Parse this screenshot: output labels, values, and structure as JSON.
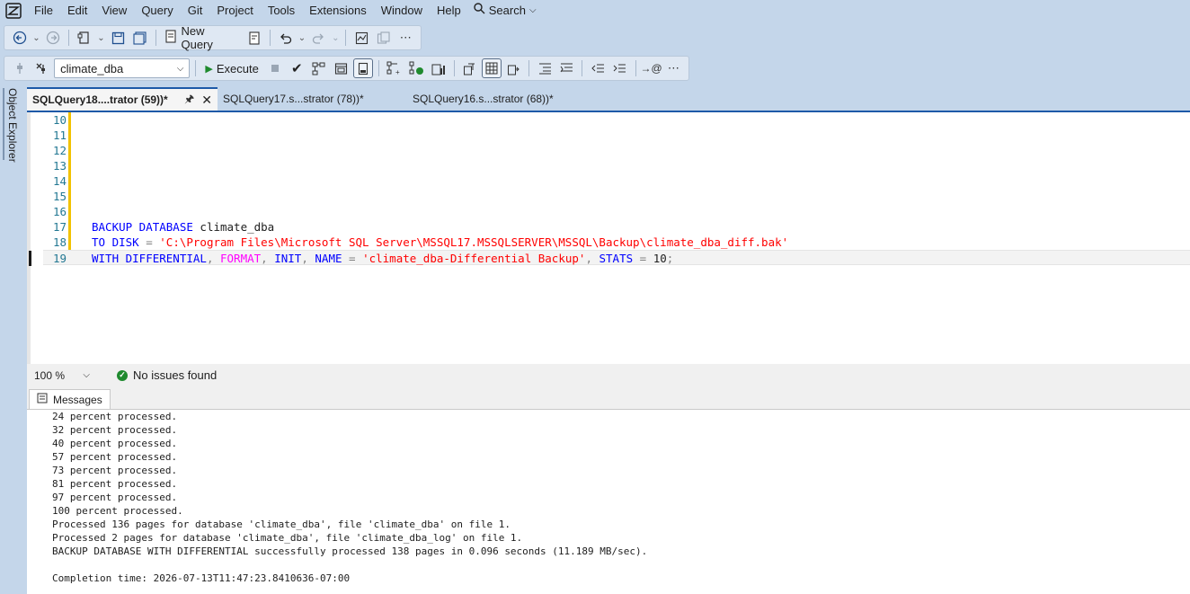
{
  "menu": {
    "items": [
      "File",
      "Edit",
      "View",
      "Query",
      "Git",
      "Project",
      "Tools",
      "Extensions",
      "Window",
      "Help"
    ],
    "search_label": "Search"
  },
  "toolbar1": {
    "new_query_label": "New Query"
  },
  "toolbar2": {
    "database": "climate_dba",
    "execute_label": "Execute"
  },
  "object_explorer": {
    "label": "Object Explorer"
  },
  "tabs": [
    {
      "label": "SQLQuery18....trator (59))*",
      "active": true
    },
    {
      "label": "SQLQuery17.s...strator (78))*",
      "active": false
    },
    {
      "label": "SQLQuery16.s...strator (68))*",
      "active": false
    }
  ],
  "editor": {
    "line_numbers": [
      "10",
      "11",
      "12",
      "13",
      "14",
      "15",
      "16",
      "17",
      "18",
      "19"
    ],
    "line17": {
      "kw": "BACKUP DATABASE",
      "text": " climate_dba"
    },
    "line18": {
      "kw": "TO DISK",
      "op": " = ",
      "str": "'C:\\Program Files\\Microsoft SQL Server\\MSSQL17.MSSQLSERVER\\MSSQL\\Backup\\climate_dba_diff.bak'"
    },
    "line19": {
      "kw1": "WITH DIFFERENTIAL",
      "c1": ", ",
      "fn": "FORMAT",
      "c2": ", ",
      "kw2": "INIT",
      "c3": ", ",
      "kw3": "NAME",
      "eq": " = ",
      "str": "'climate_dba-Differential Backup'",
      "c4": ", ",
      "kw4": "STATS",
      "eq2": " = ",
      "num": "10",
      "semi": ";"
    }
  },
  "status": {
    "zoom": "100 %",
    "issues": "No issues found"
  },
  "results": {
    "tab_label": "Messages",
    "lines": [
      "24 percent processed.",
      "32 percent processed.",
      "40 percent processed.",
      "57 percent processed.",
      "73 percent processed.",
      "81 percent processed.",
      "97 percent processed.",
      "100 percent processed.",
      "Processed 136 pages for database 'climate_dba', file 'climate_dba' on file 1.",
      "Processed 2 pages for database 'climate_dba', file 'climate_dba_log' on file 1.",
      "BACKUP DATABASE WITH DIFFERENTIAL successfully processed 138 pages in 0.096 seconds (11.189 MB/sec).",
      "",
      "Completion time: 2026-07-13T11:47:23.8410636-07:00"
    ]
  },
  "colors": {
    "accent": "#1e5aa8",
    "chrome": "#c4d6ea",
    "keyword": "#0000ff",
    "string": "#ff0000",
    "function": "#ff00ff"
  }
}
